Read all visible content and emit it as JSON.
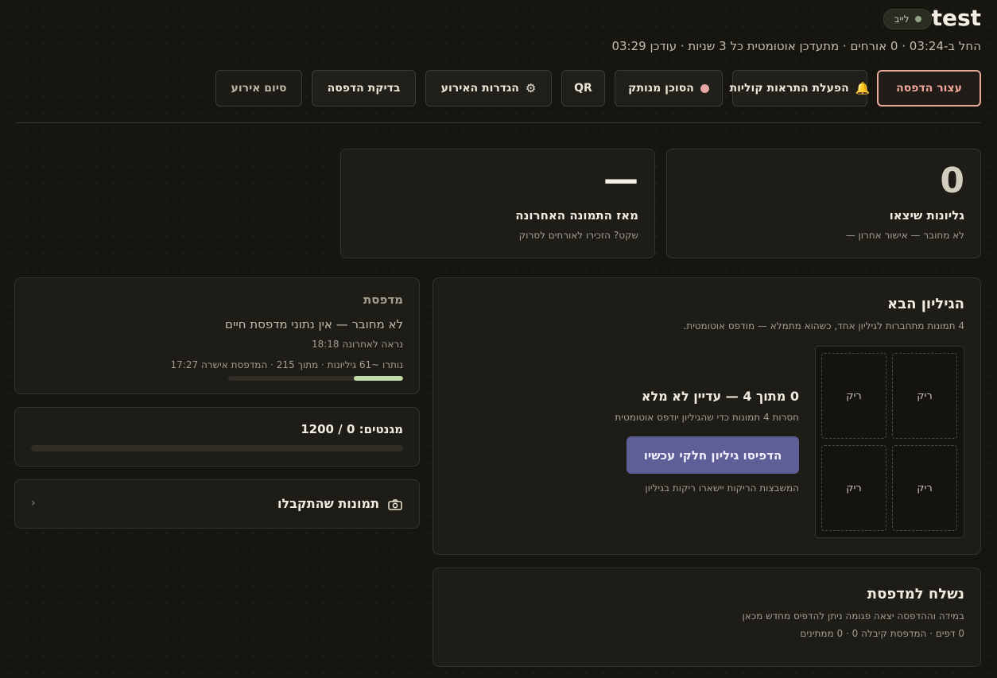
{
  "header": {
    "title": "test",
    "live_label": "לייב",
    "subtitle": "החל ב-03:24 · 0 אורחים · מתעדכן אוטומטית כל 3 שניות · עודכן 03:29"
  },
  "toolbar": {
    "pause_print": "עצור הדפסה",
    "enable_voice_alerts": "הפעלת התראות קוליות",
    "agent_disconnected": "הסוכן מנותק",
    "qr": "QR",
    "event_settings": "הגדרות האירוע",
    "test_print": "בדיקת הדפסה",
    "end_event": "סיום אירוע"
  },
  "stats": {
    "sheets_out": {
      "value": "0",
      "label": "גליונות שיצאו",
      "sub": "לא מחובר — אישור אחרון —"
    },
    "since_last_photo": {
      "value": "—",
      "label": "מאז התמונה האחרונה",
      "sub": "שקט? הזכירו לאורחים לסרוק"
    }
  },
  "printer": {
    "heading": "מדפסת",
    "status": "לא מחובר — אין נתוני מדפסת חיים",
    "last_seen": "נראה לאחרונה 18:18",
    "remaining": "נותרו ~61 גיליונות · מתוך 215 · המדפסת אישרה 17:27",
    "remaining_fraction": 0.28
  },
  "magnets": {
    "label": "מגנטים: 0 / 1200",
    "used": 0,
    "total": 1200
  },
  "received_photos": {
    "label": "תמונות שהתקבלו",
    "chevron": "‹"
  },
  "next_sheet": {
    "title": "הגיליון הבא",
    "description": "4 תמונות מתחברות לגיליון אחד, כשהוא מתמלא — מודפס אוטומטית.",
    "count_status": "0 מתוך 4 — עדיין לא מלא",
    "missing_note": "חסרות 4 תמונות כדי שהגיליון יודפס אוטומטית",
    "print_partial_button": "הדפיסו גיליון חלקי עכשיו",
    "empty_slots_note": "המשבצות הריקות יישארו ריקות בגיליון",
    "slots": [
      "ריק",
      "ריק",
      "ריק",
      "ריק"
    ]
  },
  "sent_to_printer": {
    "title": "נשלח למדפסת",
    "description": "במידה וההדפסה יצאה פגומה ניתן להדפיס מחדש מכאן",
    "stats": "0 דפים · המדפסת קיבלה 0 · 0 ממתינים"
  },
  "colors": {
    "background": "#161510",
    "card": "#1d1c17",
    "danger": "#e8a99a",
    "accent_button": "#5e5f97",
    "progress_fill": "#bfd9a8",
    "live_dot": "#93a17f",
    "status_dot": "#e8a5a5",
    "bell": "#e6b43c"
  }
}
